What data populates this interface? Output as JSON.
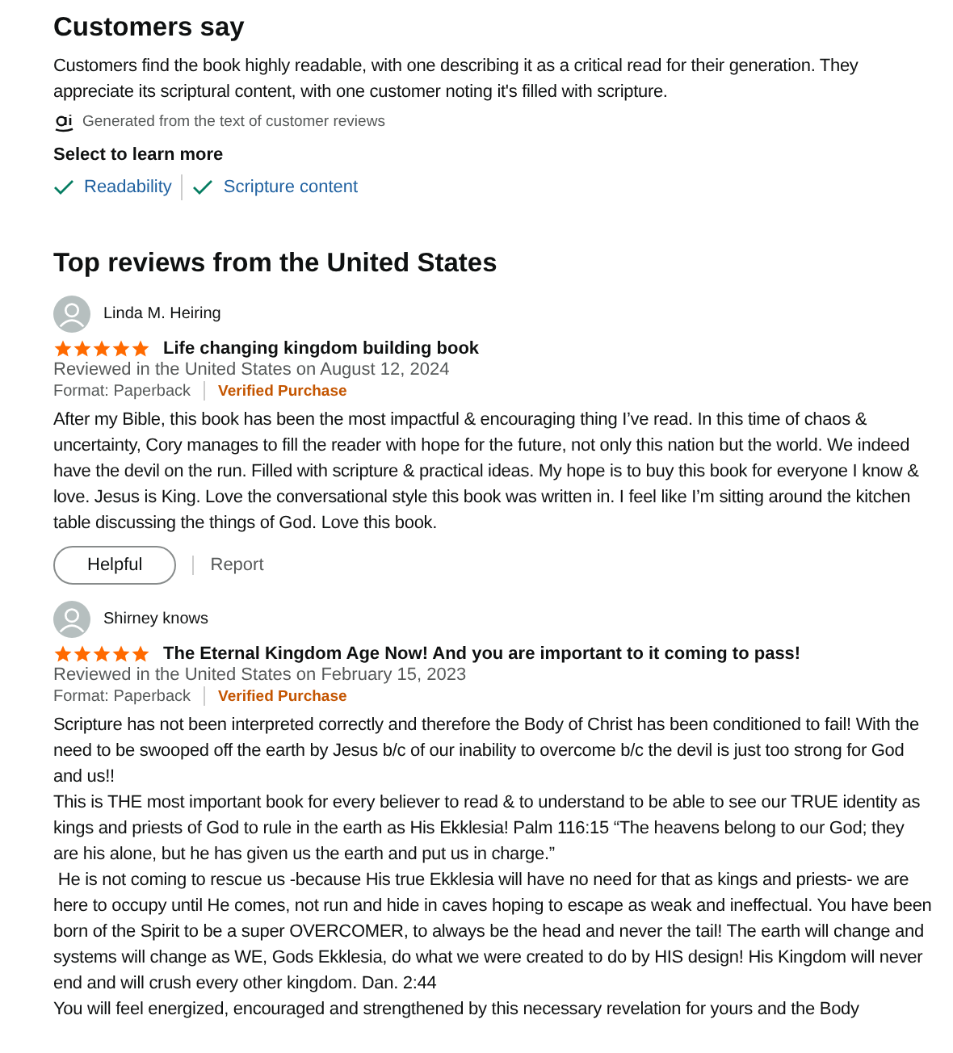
{
  "summary": {
    "title": "Customers say",
    "text": "Customers find the book highly readable, with one describing it as a critical read for their generation. They appreciate its scriptural content, with one customer noting it's filled with scripture.",
    "ai_note": "Generated from the text of customer reviews",
    "select_label": "Select to learn more",
    "aspects": [
      "Readability",
      "Scripture content"
    ]
  },
  "reviews_title": "Top reviews from the United States",
  "reviews": [
    {
      "author": "Linda M. Heiring",
      "stars": 5,
      "title": "Life changing kingdom building book",
      "date": "Reviewed in the United States on August 12, 2024",
      "format": "Format: Paperback",
      "verified": "Verified Purchase",
      "body": [
        "After my Bible, this book has been the most impactful & encouraging thing I’ve read. In this time of chaos & uncertainty, Cory manages to fill the reader with hope for the future, not only this nation but the world. We indeed have the devil on the run. Filled with scripture & practical ideas. My hope is to buy this book for everyone I know & love. Jesus is King. Love the conversational style this book was written in. I feel like I’m sitting around the kitchen table discussing the things of God. Love this book."
      ],
      "helpful": "Helpful",
      "report": "Report"
    },
    {
      "author": "Shirney knows",
      "stars": 5,
      "title": "The Eternal Kingdom Age Now! And you are important to it coming to pass!",
      "date": "Reviewed in the United States on February 15, 2023",
      "format": "Format: Paperback",
      "verified": "Verified Purchase",
      "body": [
        "Scripture has not been interpreted correctly and therefore the Body of Christ has been conditioned to fail! With the need to be swooped off the earth by Jesus b/c of our inability to overcome b/c the devil is just too strong for God and us!!",
        "This is THE most important book for every believer to read & to understand to be able to see our TRUE identity as kings and priests of God to rule in the earth as His Ekklesia! Palm 116:15 “The heavens belong to our God; they are his alone, but he has given us the earth and put us in charge.”",
        " He is not coming to rescue us -because His true Ekklesia will have no need for that as kings and priests- we are here to occupy until He comes, not run and hide in caves hoping to escape as weak and ineffectual. You have been born of the Spirit to be a super OVERCOMER, to always be the head and never the tail! The earth will change and systems will change as WE, Gods Ekklesia, do what we were created to do by HIS design! His Kingdom will never end and will crush every other kingdom. Dan. 2:44",
        "You will feel energized, encouraged and strengthened by this necessary revelation for yours and the Body"
      ]
    }
  ]
}
